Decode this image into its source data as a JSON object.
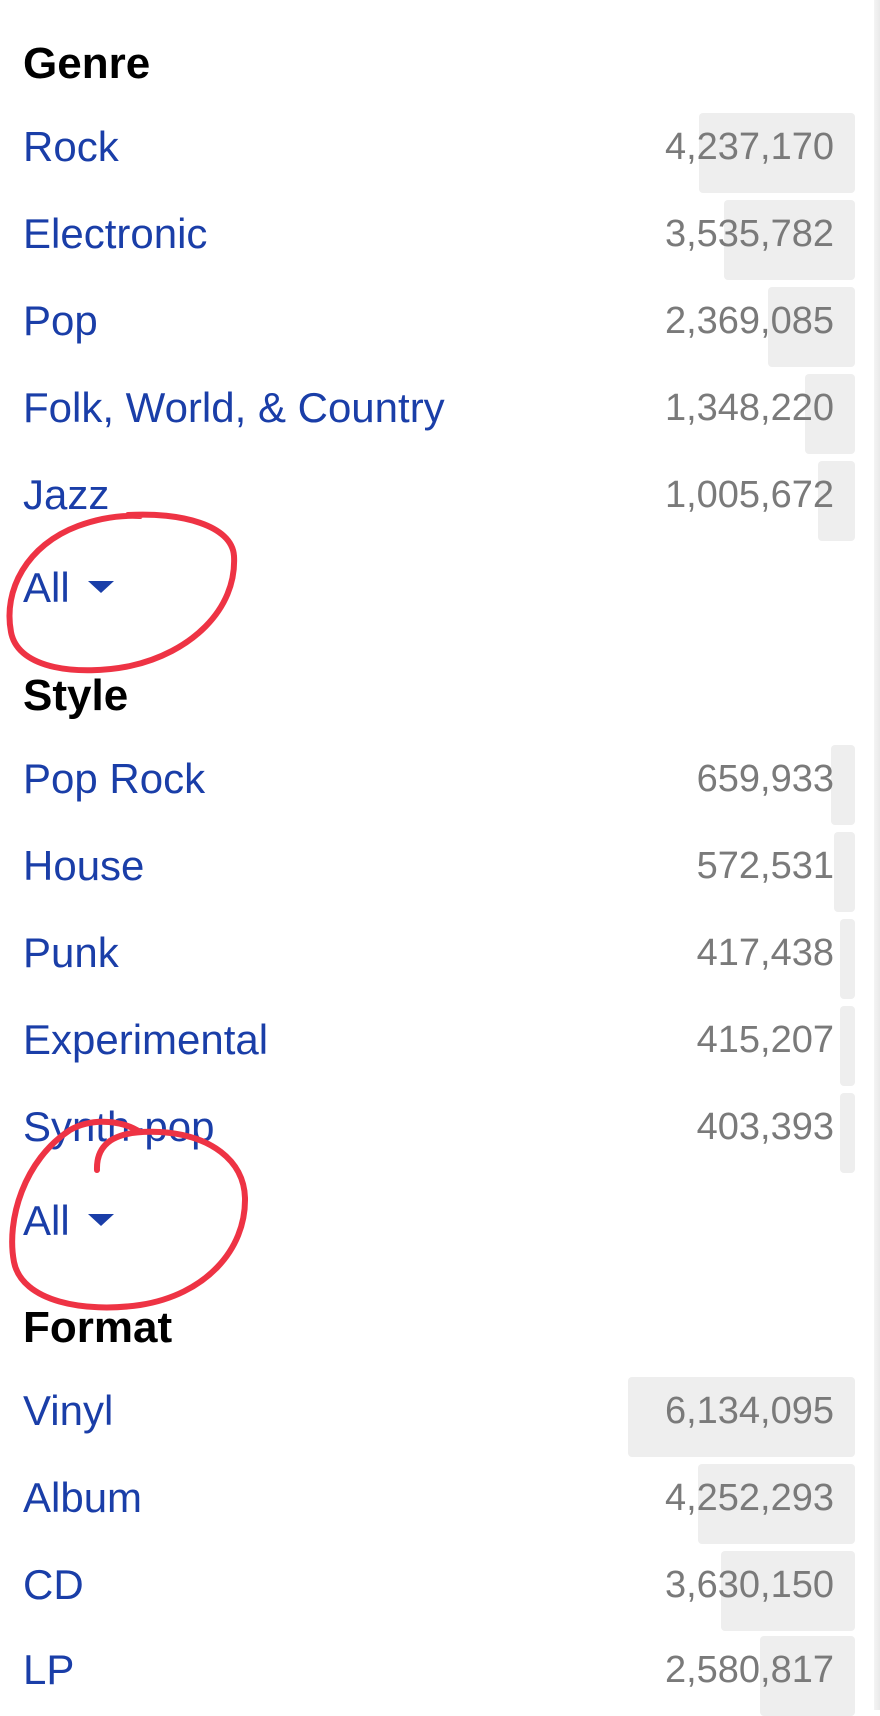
{
  "genre": {
    "title": "Genre",
    "items": [
      {
        "label": "Rock",
        "count": "4,237,170",
        "share": 0.183
      },
      {
        "label": "Electronic",
        "count": "3,535,782",
        "share": 0.153
      },
      {
        "label": "Pop",
        "count": "2,369,085",
        "share": 0.102
      },
      {
        "label": "Folk, World, & Country",
        "count": "1,348,220",
        "share": 0.058
      },
      {
        "label": "Jazz",
        "count": "1,005,672",
        "share": 0.043
      }
    ],
    "all_label": "All"
  },
  "style": {
    "title": "Style",
    "items": [
      {
        "label": "Pop Rock",
        "count": "659,933",
        "share": 0.028
      },
      {
        "label": "House",
        "count": "572,531",
        "share": 0.025
      },
      {
        "label": "Punk",
        "count": "417,438",
        "share": 0.018
      },
      {
        "label": "Experimental",
        "count": "415,207",
        "share": 0.018
      },
      {
        "label": "Synth-pop",
        "count": "403,393",
        "share": 0.017
      }
    ],
    "all_label": "All"
  },
  "format": {
    "title": "Format",
    "items": [
      {
        "label": "Vinyl",
        "count": "6,134,095",
        "share": 0.265
      },
      {
        "label": "Album",
        "count": "4,252,293",
        "share": 0.184
      },
      {
        "label": "CD",
        "count": "3,630,150",
        "share": 0.157
      },
      {
        "label": "LP",
        "count": "2,580,817",
        "share": 0.111
      }
    ]
  },
  "colors": {
    "link": "#1a3ea8",
    "count": "#7a7a7a",
    "bar": "#eeeeee",
    "annotation": "#ee3344"
  },
  "icons": {
    "expand": "caret-down-icon"
  }
}
